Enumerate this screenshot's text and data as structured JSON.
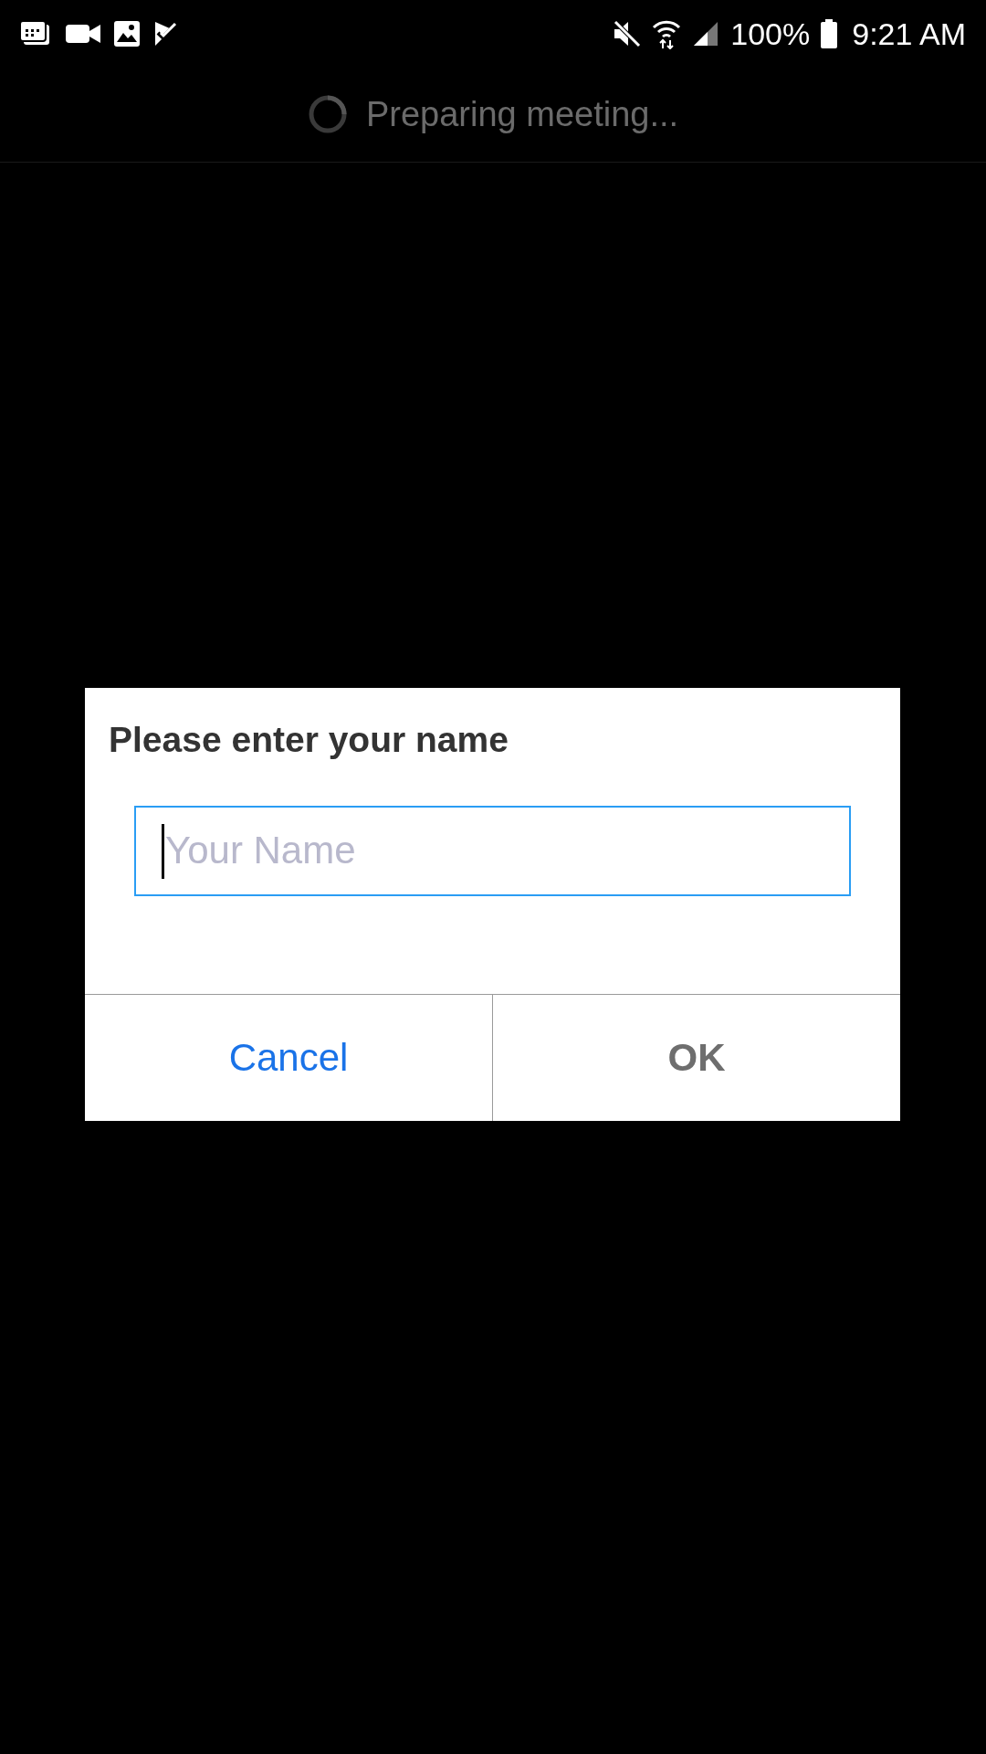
{
  "status_bar": {
    "battery": "100%",
    "time": "9:21 AM"
  },
  "header": {
    "title": "Preparing meeting..."
  },
  "dialog": {
    "title": "Please enter your name",
    "name_field": {
      "placeholder": "Your Name"
    },
    "buttons": [
      {
        "label": "Cancel",
        "kind": "secondary"
      },
      {
        "label": "OK",
        "kind": "primary"
      }
    ]
  }
}
